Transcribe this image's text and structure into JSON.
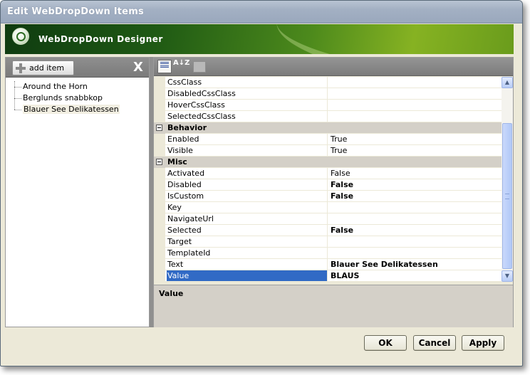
{
  "window": {
    "title": "Edit WebDropDown Items"
  },
  "banner": {
    "title": "WebDropDown Designer"
  },
  "left": {
    "add_label": "add item",
    "delete_glyph": "X",
    "items": [
      "Around the Horn",
      "Berglunds snabbkop",
      "Blauer See Delikatessen"
    ],
    "selected_index": 2
  },
  "toolbar": {
    "sort_alpha_glyph": "A↓Z"
  },
  "grid": {
    "rows": [
      {
        "name": "CssClass",
        "value": ""
      },
      {
        "name": "DisabledCssClass",
        "value": ""
      },
      {
        "name": "HoverCssClass",
        "value": ""
      },
      {
        "name": "SelectedCssClass",
        "value": ""
      },
      {
        "category": "Behavior"
      },
      {
        "name": "Enabled",
        "value": "True"
      },
      {
        "name": "Visible",
        "value": "True"
      },
      {
        "category": "Misc"
      },
      {
        "name": "Activated",
        "value": "False"
      },
      {
        "name": "Disabled",
        "value": "False",
        "bold": true
      },
      {
        "name": "IsCustom",
        "value": "False",
        "bold": true
      },
      {
        "name": "Key",
        "value": ""
      },
      {
        "name": "NavigateUrl",
        "value": ""
      },
      {
        "name": "Selected",
        "value": "False",
        "bold": true
      },
      {
        "name": "Target",
        "value": ""
      },
      {
        "name": "TemplateId",
        "value": ""
      },
      {
        "name": "Text",
        "value": "Blauer See Delikatessen",
        "bold": true
      },
      {
        "name": "Value",
        "value": "BLAUS",
        "bold": true,
        "selected": true
      }
    ]
  },
  "description": {
    "title": "Value"
  },
  "buttons": {
    "ok": "OK",
    "cancel": "Cancel",
    "apply": "Apply"
  },
  "colors": {
    "selection": "#316ac5",
    "banner_green": "#4d8a1c"
  }
}
